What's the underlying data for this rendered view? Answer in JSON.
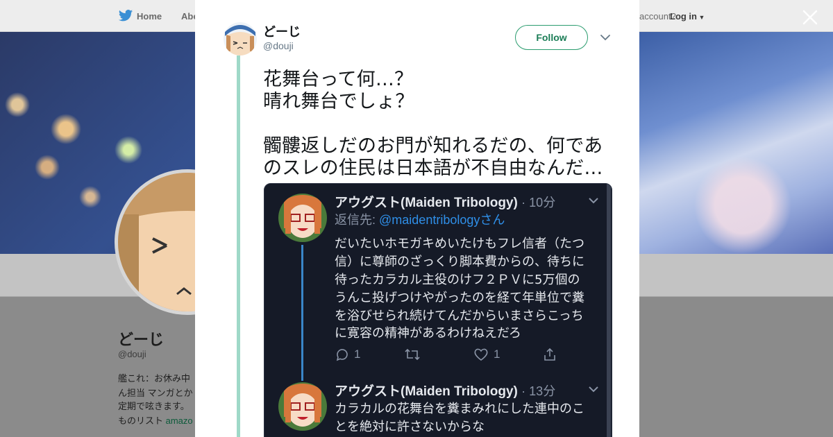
{
  "background": {
    "nav": {
      "home": "Home",
      "about": "Abo",
      "account_prompt": "account?",
      "login": "Log in"
    },
    "profile": {
      "name": "どーじ",
      "handle": "@douji",
      "bio_lines": [
        "艦これ：お休み中",
        "ん担当 マンガとか",
        "定期で呟きます。",
        "ものリスト "
      ],
      "bio_link": "amazo"
    }
  },
  "modal": {
    "author": {
      "name": "どーじ",
      "handle": "@douji"
    },
    "follow_label": "Follow",
    "tweet_lines": [
      "花舞台って何…？",
      "晴れ舞台でしょ？",
      "",
      "髑髏返しだのお門が知れるだの、何であ",
      "のスレの住民は日本語が不自由なんだ…"
    ],
    "embedded": {
      "tweets": [
        {
          "name": "アウグスト(Maiden Tribology)",
          "time": "· 10分",
          "reply_prefix": "返信先: ",
          "reply_to": "@maidentribologyさん",
          "lines": [
            "だいたいホモガキめいたけもフレ信者（たつ",
            "信）に尊師のざっくり脚本費からの、待ちに",
            "待ったカラカル主役のけフ２ＰＶに5万個の",
            "うんこ投げつけやがったのを経て年単位で糞",
            "を浴びせられ続けてんだからいまさらこっち",
            "に寛容の精神があるわけねえだろ"
          ],
          "actions": {
            "replies": "1",
            "likes": "1"
          }
        },
        {
          "name": "アウグスト(Maiden Tribology)",
          "time": "· 13分",
          "lines": [
            "カラカルの花舞台を糞まみれにした連中のこ",
            "とを絶対に許さないからな"
          ]
        }
      ]
    }
  },
  "colors": {
    "follow_accent": "#1b7d56",
    "thread_line": "#9fd9c8",
    "embed_bg": "#151a27",
    "mention": "#2f8fe8"
  },
  "icons": [
    "twitter-bird-icon",
    "close-icon",
    "chevron-down-icon",
    "reply-icon",
    "retweet-icon",
    "like-icon",
    "share-icon"
  ]
}
